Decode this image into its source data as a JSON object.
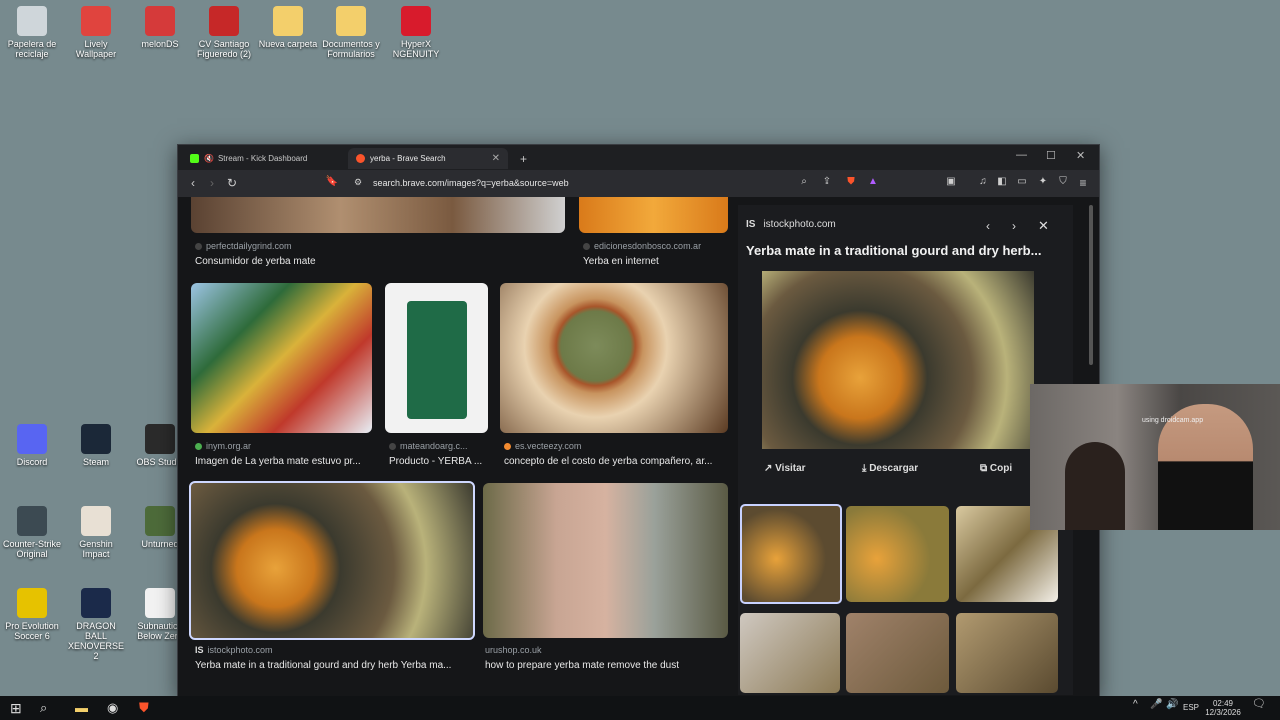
{
  "desktop": {
    "icons": [
      {
        "label": "Papelera de reciclaje",
        "name": "recycle-bin-icon",
        "color": "#cfd6da"
      },
      {
        "label": "Lively Wallpaper",
        "name": "lively-wallpaper-icon",
        "color": "#e0443e"
      },
      {
        "label": "melonDS",
        "name": "melonds-icon",
        "color": "#d53a3a"
      },
      {
        "label": "CV Santiago Figueredo (2)",
        "name": "pdf-file-icon",
        "color": "#c62828"
      },
      {
        "label": "Nueva carpeta",
        "name": "folder-icon",
        "color": "#f3cf6b"
      },
      {
        "label": "Documentos y Formularios",
        "name": "folder-icon",
        "color": "#f3cf6b"
      },
      {
        "label": "HyperX NGENUITY",
        "name": "hyperx-icon",
        "color": "#d81b2c"
      },
      {
        "label": "Discord",
        "name": "discord-icon",
        "color": "#5865f2"
      },
      {
        "label": "Steam",
        "name": "steam-icon",
        "color": "#1b2838"
      },
      {
        "label": "OBS Studio",
        "name": "obs-icon",
        "color": "#2b2b2b"
      },
      {
        "label": "Counter-Strike Original",
        "name": "counter-strike-icon",
        "color": "#3c4a52"
      },
      {
        "label": "Genshin Impact",
        "name": "genshin-icon",
        "color": "#e8e0d4"
      },
      {
        "label": "Unturned",
        "name": "unturned-icon",
        "color": "#4d6b3a"
      },
      {
        "label": "Pro Evolution Soccer 6",
        "name": "pes6-icon",
        "color": "#e6c200"
      },
      {
        "label": "DRAGON BALL XENOVERSE 2",
        "name": "dragonball-icon",
        "color": "#1b2a4a"
      },
      {
        "label": "Subnautica Below Zero",
        "name": "file-icon",
        "color": "#f2f2f2"
      }
    ]
  },
  "browser": {
    "tabs": [
      {
        "label": "Stream - Kick Dashboard",
        "name": "tab-kick",
        "color": "#53fc18"
      },
      {
        "label": "yerba - Brave Search",
        "name": "tab-brave-search",
        "color": "#fb542b"
      }
    ],
    "new_tab": "+",
    "url": "search.brave.com/images?q=yerba&source=web"
  },
  "results": [
    {
      "source": "perfectdailygrind.com",
      "caption": "Consumidor de yerba mate"
    },
    {
      "source": "edicionesdonbosco.com.ar",
      "caption": "Yerba en internet"
    },
    {
      "source": "inym.org.ar",
      "caption": "Imagen de La yerba mate estuvo pr..."
    },
    {
      "source": "mateandoarg.c...",
      "caption": "Producto - YERBA ..."
    },
    {
      "source": "es.vecteezy.com",
      "caption": "concepto de el costo de yerba compañero, ar..."
    },
    {
      "source": "istockphoto.com",
      "caption": "Yerba mate in a traditional gourd and dry herb Yerba ma..."
    },
    {
      "source": "urushop.co.uk",
      "caption": "how to prepare yerba mate remove the dust"
    }
  ],
  "panel": {
    "source_abbr": "IS",
    "source": "istockphoto.com",
    "title": "Yerba mate in a traditional gourd and dry herb...",
    "visit": "Visitar",
    "download": "Descargar",
    "copy": "Copi"
  },
  "taskbar": {
    "lang": "ESP",
    "time": "02:49",
    "date": "12/3/2026"
  },
  "cam": {
    "watermark": "using droidcam.app"
  }
}
